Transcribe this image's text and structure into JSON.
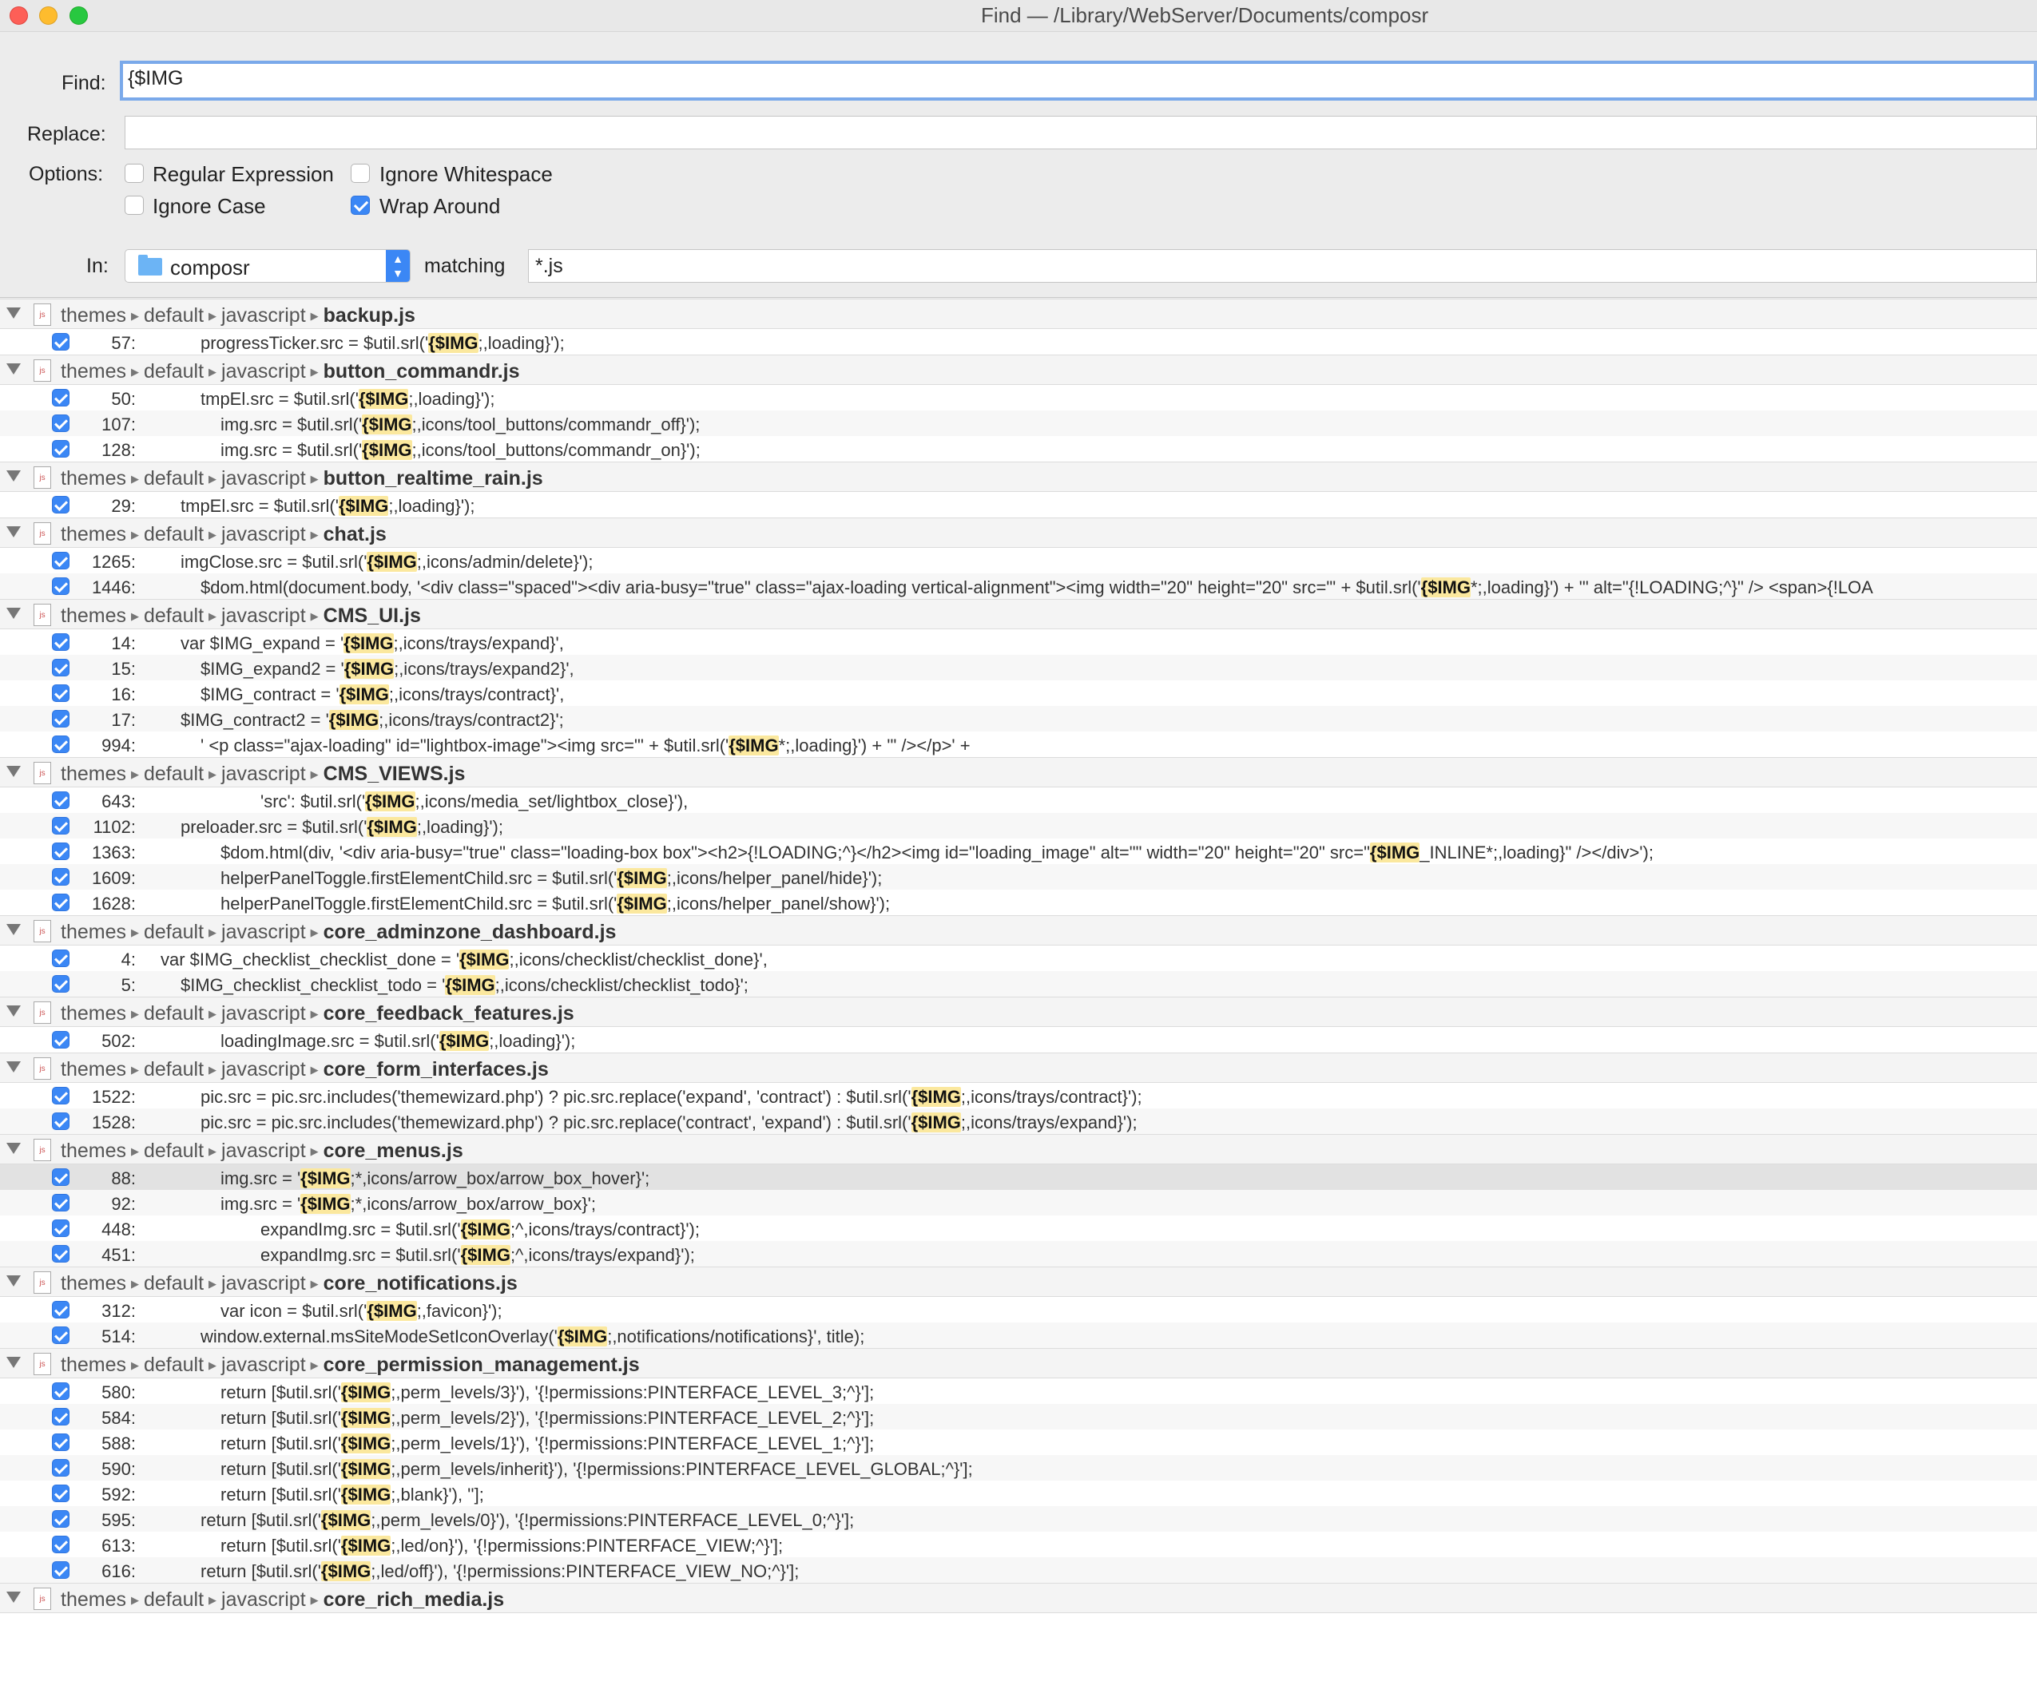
{
  "window": {
    "title": "Find — /Library/WebServer/Documents/composr"
  },
  "form": {
    "find_label": "Find:",
    "find_value": "{$IMG",
    "replace_label": "Replace:",
    "replace_value": "",
    "options_label": "Options:",
    "options": {
      "regex": {
        "label": "Regular Expression",
        "checked": false
      },
      "ignore_whitespace": {
        "label": "Ignore Whitespace",
        "checked": false
      },
      "ignore_case": {
        "label": "Ignore Case",
        "checked": false
      },
      "wrap_around": {
        "label": "Wrap Around",
        "checked": true
      }
    },
    "in_label": "In:",
    "in_value": "composr",
    "matching_label": "matching",
    "matching_value": "*.js"
  },
  "results": [
    {
      "path": [
        "themes",
        "default",
        "javascript"
      ],
      "file": "backup.js",
      "matches": [
        {
          "line": "57:",
          "indent": 1,
          "pre": "progressTicker.src = $util.srl('",
          "hl": "{$IMG",
          "post": ";,loading}');"
        }
      ]
    },
    {
      "path": [
        "themes",
        "default",
        "javascript"
      ],
      "file": "button_commandr.js",
      "matches": [
        {
          "line": "50:",
          "indent": 1,
          "pre": "tmpEl.src = $util.srl('",
          "hl": "{$IMG",
          "post": ";,loading}');"
        },
        {
          "line": "107:",
          "indent": 2,
          "pre": "img.src = $util.srl('",
          "hl": "{$IMG",
          "post": ";,icons/tool_buttons/commandr_off}');"
        },
        {
          "line": "128:",
          "indent": 2,
          "pre": "img.src = $util.srl('",
          "hl": "{$IMG",
          "post": ";,icons/tool_buttons/commandr_on}');"
        }
      ]
    },
    {
      "path": [
        "themes",
        "default",
        "javascript"
      ],
      "file": "button_realtime_rain.js",
      "matches": [
        {
          "line": "29:",
          "indent": 0,
          "pre": "tmpEl.src = $util.srl('",
          "hl": "{$IMG",
          "post": ";,loading}');"
        }
      ]
    },
    {
      "path": [
        "themes",
        "default",
        "javascript"
      ],
      "file": "chat.js",
      "matches": [
        {
          "line": "1265:",
          "indent": 0,
          "pre": "imgClose.src = $util.srl('",
          "hl": "{$IMG",
          "post": ";,icons/admin/delete}');"
        },
        {
          "line": "1446:",
          "indent": 1,
          "pre": "$dom.html(document.body, '<div class=\"spaced\"><div aria-busy=\"true\" class=\"ajax-loading vertical-alignment\"><img width=\"20\" height=\"20\" src=\"' + $util.srl('",
          "hl": "{$IMG",
          "post": "*;,loading}') + '\" alt=\"{!LOADING;^}\" /> <span>{!LOA"
        }
      ]
    },
    {
      "path": [
        "themes",
        "default",
        "javascript"
      ],
      "file": "CMS_UI.js",
      "matches": [
        {
          "line": "14:",
          "indent": 0,
          "pre": "var $IMG_expand = '",
          "hl": "{$IMG",
          "post": ";,icons/trays/expand}',"
        },
        {
          "line": "15:",
          "indent": 1,
          "pre": "$IMG_expand2 = '",
          "hl": "{$IMG",
          "post": ";,icons/trays/expand2}',"
        },
        {
          "line": "16:",
          "indent": 1,
          "pre": "$IMG_contract = '",
          "hl": "{$IMG",
          "post": ";,icons/trays/contract}',"
        },
        {
          "line": "17:",
          "indent": 0,
          "pre": "$IMG_contract2 = '",
          "hl": "{$IMG",
          "post": ";,icons/trays/contract2}';"
        },
        {
          "line": "994:",
          "indent": 1,
          "pre": "'    <p class=\"ajax-loading\" id=\"lightbox-image\"><img src=\"' + $util.srl('",
          "hl": "{$IMG",
          "post": "*;,loading}') + '\" /></p>' +"
        }
      ]
    },
    {
      "path": [
        "themes",
        "default",
        "javascript"
      ],
      "file": "CMS_VIEWS.js",
      "matches": [
        {
          "line": "643:",
          "indent": 4,
          "pre": "'src': $util.srl('",
          "hl": "{$IMG",
          "post": ";,icons/media_set/lightbox_close}'),"
        },
        {
          "line": "1102:",
          "indent": 0,
          "pre": "preloader.src = $util.srl('",
          "hl": "{$IMG",
          "post": ";,loading}');"
        },
        {
          "line": "1363:",
          "indent": 2,
          "pre": "$dom.html(div, '<div aria-busy=\"true\" class=\"loading-box box\"><h2>{!LOADING;^}</h2><img id=\"loading_image\" alt=\"\" width=\"20\" height=\"20\" src=\"",
          "hl": "{$IMG",
          "post": "_INLINE*;,loading}\" /></div>');"
        },
        {
          "line": "1609:",
          "indent": 2,
          "pre": "helperPanelToggle.firstElementChild.src = $util.srl('",
          "hl": "{$IMG",
          "post": ";,icons/helper_panel/hide}');"
        },
        {
          "line": "1628:",
          "indent": 2,
          "pre": "helperPanelToggle.firstElementChild.src = $util.srl('",
          "hl": "{$IMG",
          "post": ";,icons/helper_panel/show}');"
        }
      ]
    },
    {
      "path": [
        "themes",
        "default",
        "javascript"
      ],
      "file": "core_adminzone_dashboard.js",
      "matches": [
        {
          "line": "4:",
          "indent": -1,
          "pre": "var $IMG_checklist_checklist_done = '",
          "hl": "{$IMG",
          "post": ";,icons/checklist/checklist_done}',"
        },
        {
          "line": "5:",
          "indent": 0,
          "pre": "$IMG_checklist_checklist_todo = '",
          "hl": "{$IMG",
          "post": ";,icons/checklist/checklist_todo}';"
        }
      ]
    },
    {
      "path": [
        "themes",
        "default",
        "javascript"
      ],
      "file": "core_feedback_features.js",
      "matches": [
        {
          "line": "502:",
          "indent": 2,
          "pre": "loadingImage.src = $util.srl('",
          "hl": "{$IMG",
          "post": ";,loading}');"
        }
      ]
    },
    {
      "path": [
        "themes",
        "default",
        "javascript"
      ],
      "file": "core_form_interfaces.js",
      "matches": [
        {
          "line": "1522:",
          "indent": 1,
          "pre": "pic.src = pic.src.includes('themewizard.php') ? pic.src.replace('expand', 'contract') : $util.srl('",
          "hl": "{$IMG",
          "post": ";,icons/trays/contract}');"
        },
        {
          "line": "1528:",
          "indent": 1,
          "pre": "pic.src = pic.src.includes('themewizard.php') ? pic.src.replace('contract', 'expand') : $util.srl('",
          "hl": "{$IMG",
          "post": ";,icons/trays/expand}');"
        }
      ]
    },
    {
      "path": [
        "themes",
        "default",
        "javascript"
      ],
      "file": "core_menus.js",
      "matches": [
        {
          "line": "88:",
          "indent": 2,
          "selected": true,
          "pre": "img.src = '",
          "hl": "{$IMG",
          "post": ";*,icons/arrow_box/arrow_box_hover}';"
        },
        {
          "line": "92:",
          "indent": 2,
          "pre": "img.src = '",
          "hl": "{$IMG",
          "post": ";*,icons/arrow_box/arrow_box}';"
        },
        {
          "line": "448:",
          "indent": 4,
          "pre": "expandImg.src = $util.srl('",
          "hl": "{$IMG",
          "post": ";^,icons/trays/contract}');"
        },
        {
          "line": "451:",
          "indent": 4,
          "pre": "expandImg.src = $util.srl('",
          "hl": "{$IMG",
          "post": ";^,icons/trays/expand}');"
        }
      ]
    },
    {
      "path": [
        "themes",
        "default",
        "javascript"
      ],
      "file": "core_notifications.js",
      "matches": [
        {
          "line": "312:",
          "indent": 2,
          "pre": "var icon = $util.srl('",
          "hl": "{$IMG",
          "post": ";,favicon}');"
        },
        {
          "line": "514:",
          "indent": 1,
          "pre": "window.external.msSiteModeSetIconOverlay('",
          "hl": "{$IMG",
          "post": ";,notifications/notifications}', title);"
        }
      ]
    },
    {
      "path": [
        "themes",
        "default",
        "javascript"
      ],
      "file": "core_permission_management.js",
      "matches": [
        {
          "line": "580:",
          "indent": 2,
          "pre": "return [$util.srl('",
          "hl": "{$IMG",
          "post": ";,perm_levels/3}'), '{!permissions:PINTERFACE_LEVEL_3;^}'];"
        },
        {
          "line": "584:",
          "indent": 2,
          "pre": "return [$util.srl('",
          "hl": "{$IMG",
          "post": ";,perm_levels/2}'), '{!permissions:PINTERFACE_LEVEL_2;^}'];"
        },
        {
          "line": "588:",
          "indent": 2,
          "pre": "return [$util.srl('",
          "hl": "{$IMG",
          "post": ";,perm_levels/1}'), '{!permissions:PINTERFACE_LEVEL_1;^}'];"
        },
        {
          "line": "590:",
          "indent": 2,
          "pre": "return [$util.srl('",
          "hl": "{$IMG",
          "post": ";,perm_levels/inherit}'), '{!permissions:PINTERFACE_LEVEL_GLOBAL;^}'];"
        },
        {
          "line": "592:",
          "indent": 2,
          "pre": "return [$util.srl('",
          "hl": "{$IMG",
          "post": ";,blank}'), ''];"
        },
        {
          "line": "595:",
          "indent": 1,
          "pre": "return [$util.srl('",
          "hl": "{$IMG",
          "post": ";,perm_levels/0}'), '{!permissions:PINTERFACE_LEVEL_0;^}'];"
        },
        {
          "line": "613:",
          "indent": 2,
          "pre": "return [$util.srl('",
          "hl": "{$IMG",
          "post": ";,led/on}'), '{!permissions:PINTERFACE_VIEW;^}'];"
        },
        {
          "line": "616:",
          "indent": 1,
          "pre": "return [$util.srl('",
          "hl": "{$IMG",
          "post": ";,led/off}'), '{!permissions:PINTERFACE_VIEW_NO;^}'];"
        }
      ]
    },
    {
      "path": [
        "themes",
        "default",
        "javascript"
      ],
      "file": "core_rich_media.js",
      "matches": []
    }
  ]
}
